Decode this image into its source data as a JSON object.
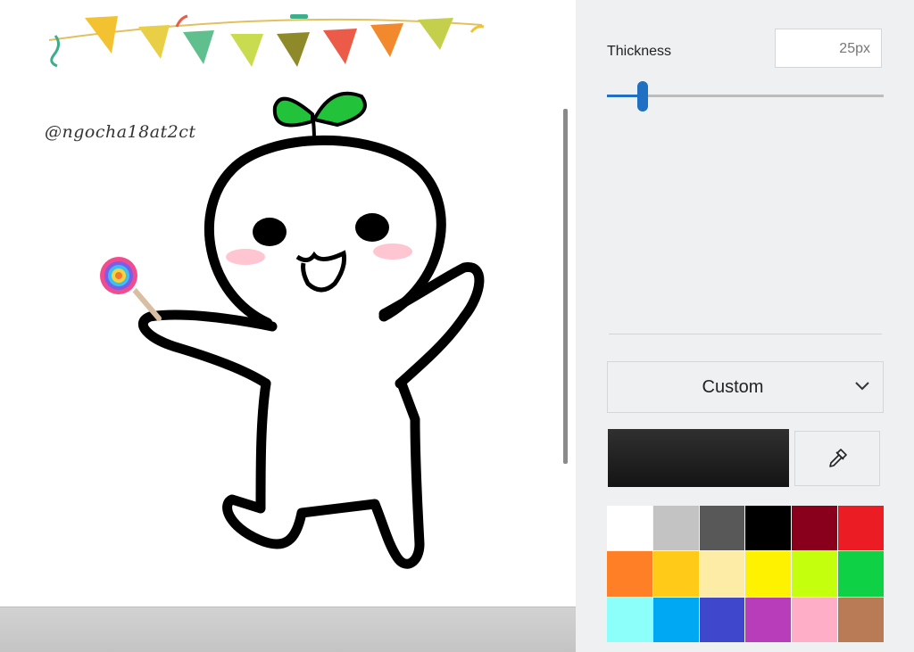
{
  "canvas": {
    "watermark": "@ngocha18at2ct"
  },
  "panel": {
    "thickness_label": "Thickness",
    "thickness_value": "25px",
    "thickness_fraction": 0.13,
    "color_mode": "Custom",
    "current_color": "#1e1e1e",
    "palette": [
      "#ffffff",
      "#c3c3c3",
      "#585858",
      "#000000",
      "#88001b",
      "#ec1c24",
      "#ff7f27",
      "#ffca18",
      "#fdeca6",
      "#fff200",
      "#c4ff0e",
      "#0ed145",
      "#8cfffb",
      "#00a8f3",
      "#3f48cc",
      "#b83dba",
      "#ffaec8",
      "#b97a56"
    ]
  },
  "icons": {
    "eyedropper": "eyedropper-icon",
    "dropdown": "chevron-down-icon"
  }
}
